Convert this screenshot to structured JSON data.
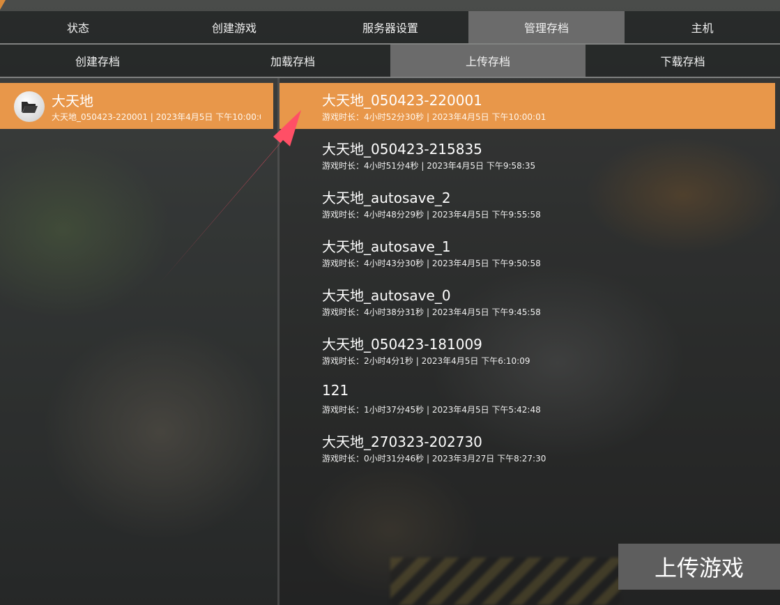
{
  "tabs_main": [
    {
      "label": "状态",
      "active": false
    },
    {
      "label": "创建游戏",
      "active": false
    },
    {
      "label": "服务器设置",
      "active": false
    },
    {
      "label": "管理存档",
      "active": true
    },
    {
      "label": "主机",
      "active": false
    }
  ],
  "tabs_sub": [
    {
      "label": "创建存档",
      "active": false
    },
    {
      "label": "加载存档",
      "active": false
    },
    {
      "label": "上传存档",
      "active": true
    },
    {
      "label": "下载存档",
      "active": false
    }
  ],
  "world": {
    "icon": "folder-open-icon",
    "title": "大天地",
    "subtitle": "大天地_050423-220001 | 2023年4月5日 下午10:00:0"
  },
  "saves": [
    {
      "title": "大天地_050423-220001",
      "meta": "游戏时长：4小时52分30秒 | 2023年4月5日 下午10:00:01",
      "selected": true
    },
    {
      "title": "大天地_050423-215835",
      "meta": "游戏时长：4小时51分4秒 | 2023年4月5日 下午9:58:35",
      "selected": false
    },
    {
      "title": "大天地_autosave_2",
      "meta": "游戏时长：4小时48分29秒 | 2023年4月5日 下午9:55:58",
      "selected": false
    },
    {
      "title": "大天地_autosave_1",
      "meta": "游戏时长：4小时43分30秒 | 2023年4月5日 下午9:50:58",
      "selected": false
    },
    {
      "title": "大天地_autosave_0",
      "meta": "游戏时长：4小时38分31秒 | 2023年4月5日 下午9:45:58",
      "selected": false
    },
    {
      "title": "大天地_050423-181009",
      "meta": "游戏时长：2小时4分1秒 | 2023年4月5日 下午6:10:09",
      "selected": false
    },
    {
      "title": "121",
      "meta": "游戏时长：1小时37分45秒 | 2023年4月5日 下午5:42:48",
      "selected": false
    },
    {
      "title": "大天地_270323-202730",
      "meta": "游戏时长：0小时31分46秒 | 2023年3月27日 下午8:27:30",
      "selected": false
    }
  ],
  "upload_button": {
    "label": "上传游戏"
  },
  "colors": {
    "accent": "#e8974a",
    "tab_active": "#6b6b6b",
    "button_bg": "#5e5e5e",
    "arrow": "#ff4f66"
  }
}
